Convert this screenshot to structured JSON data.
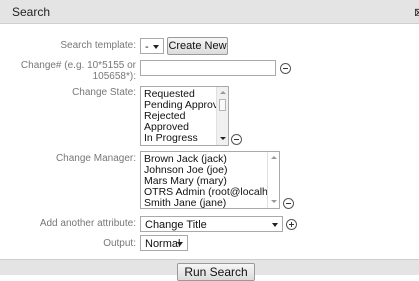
{
  "dialog": {
    "title": "Search"
  },
  "fields": {
    "search_template": {
      "label": "Search template:",
      "value": "-",
      "create_label": "Create New"
    },
    "change_number": {
      "label_line1": "Change# (e.g. 10*5155 or",
      "label_line2": "105658*):",
      "value": ""
    },
    "change_state": {
      "label": "Change State:",
      "options": [
        "Requested",
        "Pending Approval",
        "Rejected",
        "Approved",
        "In Progress"
      ]
    },
    "change_manager": {
      "label": "Change Manager:",
      "options": [
        "Brown Jack (jack)",
        "Johnson Joe (joe)",
        "Mars Mary (mary)",
        "OTRS Admin (root@localhost)",
        "Smith Jane (jane)"
      ]
    },
    "add_attribute": {
      "label": "Add another attribute:",
      "value": "Change Title"
    },
    "output": {
      "label": "Output:",
      "value": "Normal"
    }
  },
  "footer": {
    "run_label": "Run Search"
  }
}
